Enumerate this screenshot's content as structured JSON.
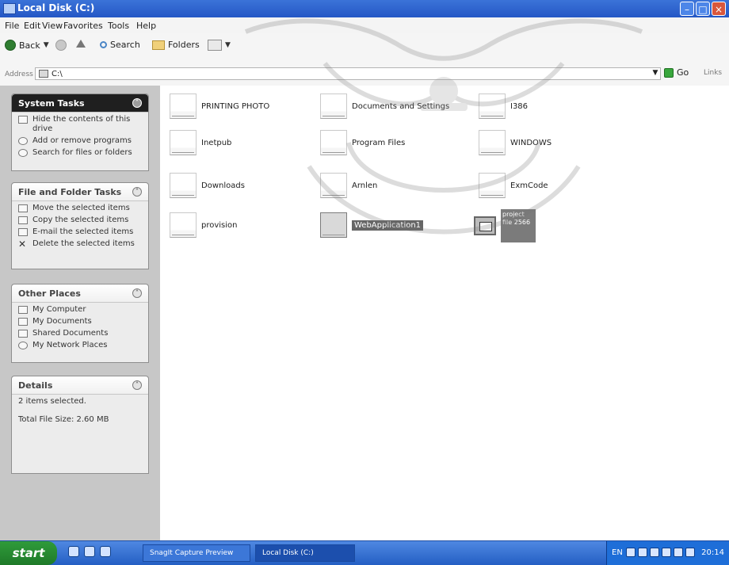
{
  "window": {
    "title": "Local Disk (C:)"
  },
  "menu": [
    "File",
    "Edit",
    "View",
    "Favorites",
    "Tools",
    "Help"
  ],
  "toolbar": {
    "back_label": "Back",
    "search_label": "Search",
    "folders_label": "Folders"
  },
  "address": {
    "label": "Address",
    "value": "C:\\",
    "go_label": "Go",
    "links_label": "Links"
  },
  "left_panel": {
    "system_tasks": {
      "title": "System Tasks",
      "items": [
        "Hide the contents of this drive",
        "Add or remove programs",
        "Search for files or folders"
      ]
    },
    "file_folder_tasks": {
      "title": "File and Folder Tasks",
      "items": [
        "Move the selected items",
        "Copy the selected items",
        "E-mail the selected items",
        "Delete the selected items"
      ]
    },
    "other_places": {
      "title": "Other Places",
      "items": [
        "My Computer",
        "My Documents",
        "Shared Documents",
        "My Network Places"
      ]
    },
    "details": {
      "title": "Details",
      "line1": "2 items selected.",
      "line2": "Total File Size: 2.60 MB"
    }
  },
  "files": [
    {
      "name": "PRINTING PHOTO"
    },
    {
      "name": "Documents and Settings"
    },
    {
      "name": "I386"
    },
    {
      "name": "Inetpub"
    },
    {
      "name": "Program Files"
    },
    {
      "name": "WINDOWS"
    },
    {
      "name": "Downloads"
    },
    {
      "name": "Arnlen"
    },
    {
      "name": "ExmCode"
    },
    {
      "name": "provision"
    },
    {
      "name": "WebApplication1"
    },
    {
      "name": "project file 2566"
    }
  ],
  "taskbar": {
    "start_label": "start",
    "tasks": [
      "SnagIt Capture Preview",
      "Local Disk (C:)"
    ],
    "language": "EN",
    "clock": "20:14"
  }
}
